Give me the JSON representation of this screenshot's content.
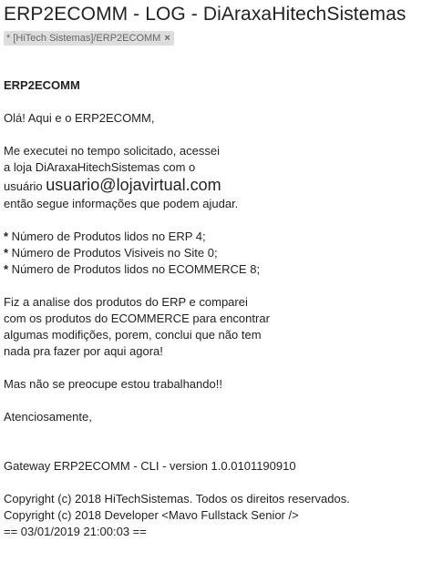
{
  "email": {
    "subject": "ERP2ECOMM - LOG - DiAraxaHitechSistemas",
    "label": {
      "star": "*",
      "text": "[HiTech Sistemas]/ERP2ECOMM",
      "close": "×"
    }
  },
  "body": {
    "heading": "ERP2ECOMM",
    "greeting": "Olá! Aqui e o ERP2ECOMM,",
    "intro_line1": "Me executei no tempo solicitado, acessei",
    "intro_line2": "a loja DiAraxaHitechSistemas com o",
    "intro_user_prefix": "usuário",
    "intro_user_value": "usuario@lojavirtual.com",
    "intro_line4": "então segue informações que podem ajudar.",
    "bullets": [
      {
        "marker": "*",
        "text": " Número de Produtos lidos no ERP 4;"
      },
      {
        "marker": "*",
        "text": " Número de Produtos Visiveis no Site 0;"
      },
      {
        "marker": "*",
        "text": " Número de Produtos lidos no ECOMMERCE 8;"
      }
    ],
    "analysis_line1": "Fiz a analise dos produtos do ERP e comparei",
    "analysis_line2": "com os produtos do ECOMMERCE para encontrar",
    "analysis_line3": "algumas modifições, porem, conclui que não tem",
    "analysis_line4": "nada pra fazer por aqui agora!",
    "reassure": "Mas não se preocupe estou trabalhando!!",
    "signoff": "Atenciosamente,",
    "gateway": "Gateway ERP2ECOMM - CLI - version 1.0.0101190910",
    "copyright1": "Copyright (c) 2018 HiTechSistemas. Todos os direitos reservados.",
    "copyright2": "Copyright (c) 2018 Developer <Mavo Fullstack Senior />",
    "timestamp": "== 03/01/2019 21:00:03 =="
  }
}
